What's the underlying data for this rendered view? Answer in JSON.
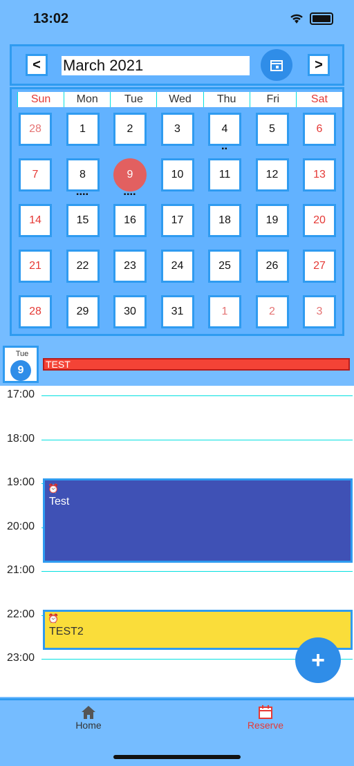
{
  "status_bar": {
    "time": "13:02"
  },
  "header": {
    "prev_label": "<",
    "month_title": "March 2021",
    "next_label": ">"
  },
  "weekdays": [
    "Sun",
    "Mon",
    "Tue",
    "Wed",
    "Thu",
    "Fri",
    "Sat"
  ],
  "calendar": {
    "rows": [
      [
        "28",
        "1",
        "2",
        "3",
        "4",
        "5",
        "6"
      ],
      [
        "7",
        "8",
        "9",
        "10",
        "11",
        "12",
        "13"
      ],
      [
        "14",
        "15",
        "16",
        "17",
        "18",
        "19",
        "20"
      ],
      [
        "21",
        "22",
        "23",
        "24",
        "25",
        "26",
        "27"
      ],
      [
        "28",
        "29",
        "30",
        "31",
        "1",
        "2",
        "3"
      ]
    ]
  },
  "day_view": {
    "weekday": "Tue",
    "day": "9"
  },
  "allday_event": {
    "title": "TEST"
  },
  "hours": [
    "17:00",
    "18:00",
    "19:00",
    "20:00",
    "21:00",
    "22:00",
    "23:00"
  ],
  "events": [
    {
      "title": "Test",
      "color": "#3f51b5"
    },
    {
      "title": "TEST2",
      "color": "#fadd3a"
    }
  ],
  "fab": {
    "label": "+"
  },
  "tabs": [
    {
      "label": "Home",
      "icon": "home-icon"
    },
    {
      "label": "Reserve",
      "icon": "calendar-icon"
    }
  ]
}
